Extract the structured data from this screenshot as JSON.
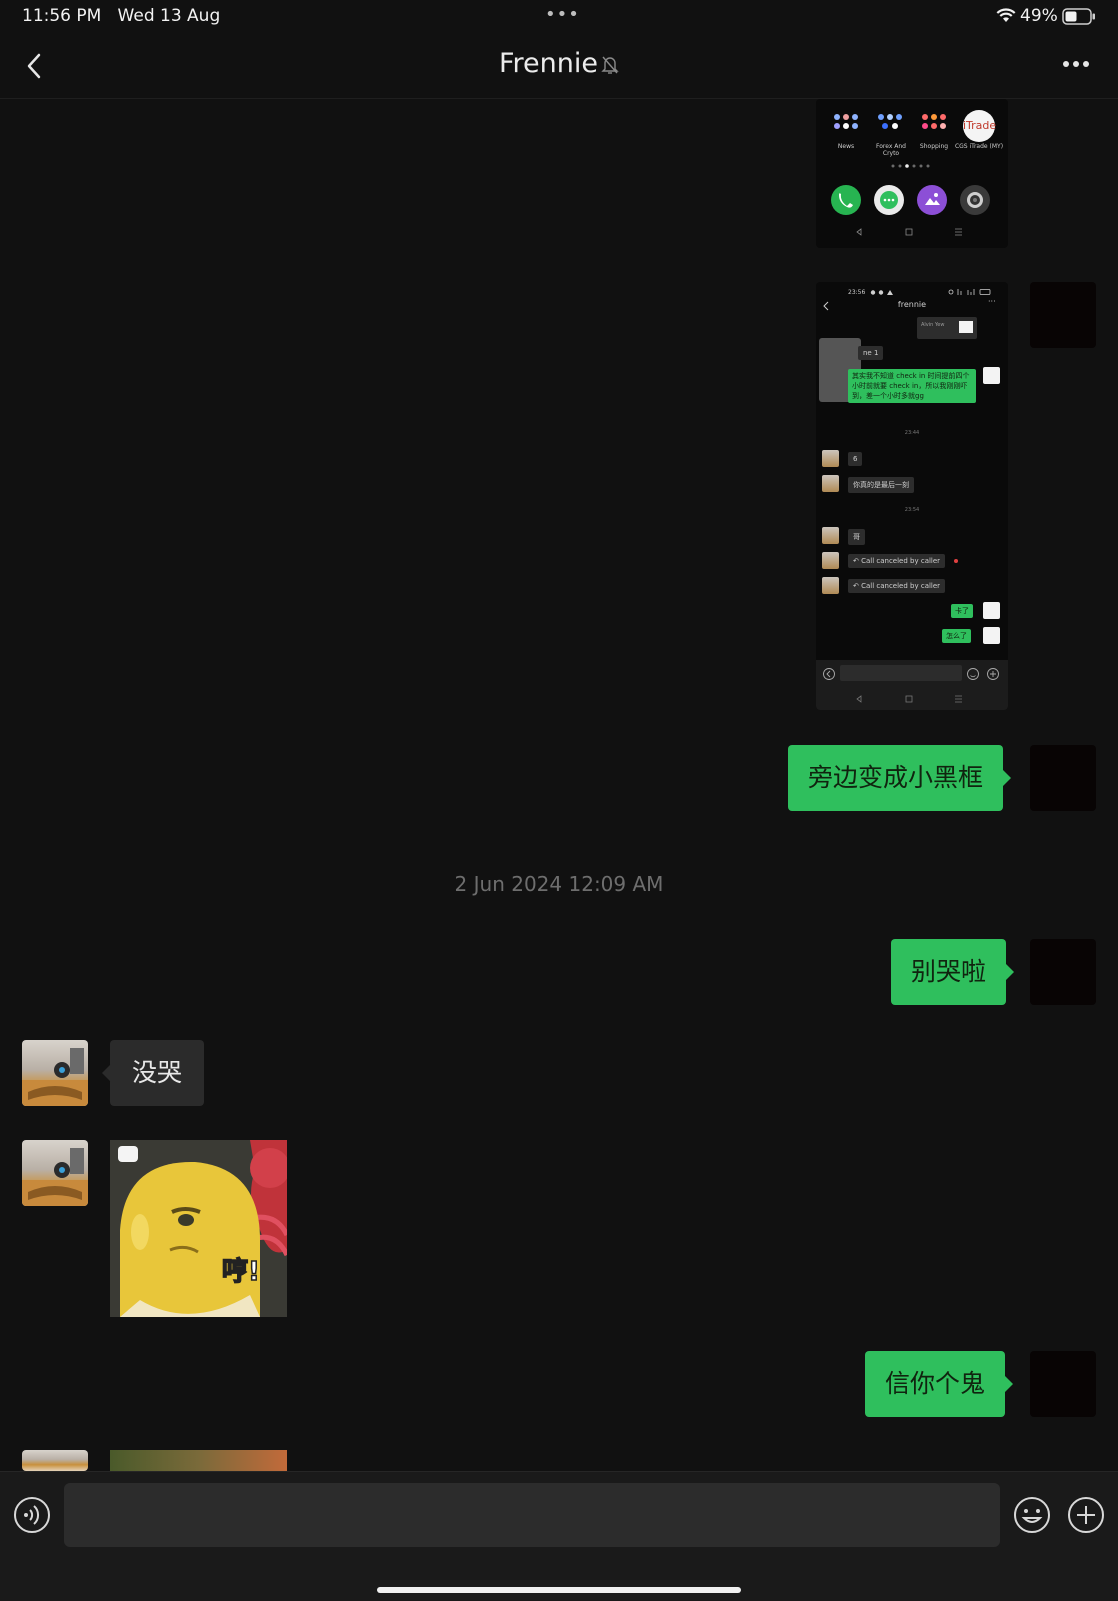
{
  "status_bar": {
    "time": "11:56 PM",
    "date": "Wed 13 Aug",
    "battery": "49%"
  },
  "nav": {
    "title": "Frennie",
    "back_icon": "chevron-left-icon",
    "mute_icon": "bell-slash-icon",
    "more_icon": "ellipsis-icon"
  },
  "shot1": {
    "apps": [
      "News",
      "Forex And Cryto",
      "Shopping",
      "CGS iTrade (MY)"
    ],
    "itrade_logo": "iTrade"
  },
  "shot2": {
    "time": "23:56",
    "title": "frennie",
    "card_name": "Alvin Yew",
    "partial": "ne 1",
    "green_msg": "其实我不知道 check in 时间提前四个小时前就要 check in，所以我刚刚吓到，差一个小时多就gg",
    "ts1": "23:44",
    "msg_6": "6",
    "msg_last": "你真的是最后一刻",
    "ts2": "23:54",
    "msg_ge": "哥",
    "call1": "Call canceled by caller",
    "call2": "Call canceled by caller",
    "msg_ka": "卡了",
    "msg_zen": "怎么了"
  },
  "messages": {
    "m1": "旁边变成小黑框",
    "timestamp": "2 Jun 2024 12:09 AM",
    "m2": "别哭啦",
    "m3": "没哭",
    "sticker_text": "哼!",
    "m4": "信你个鬼"
  },
  "input": {
    "voice_icon": "voice-icon",
    "emoji_icon": "emoji-icon",
    "plus_icon": "plus-icon"
  }
}
